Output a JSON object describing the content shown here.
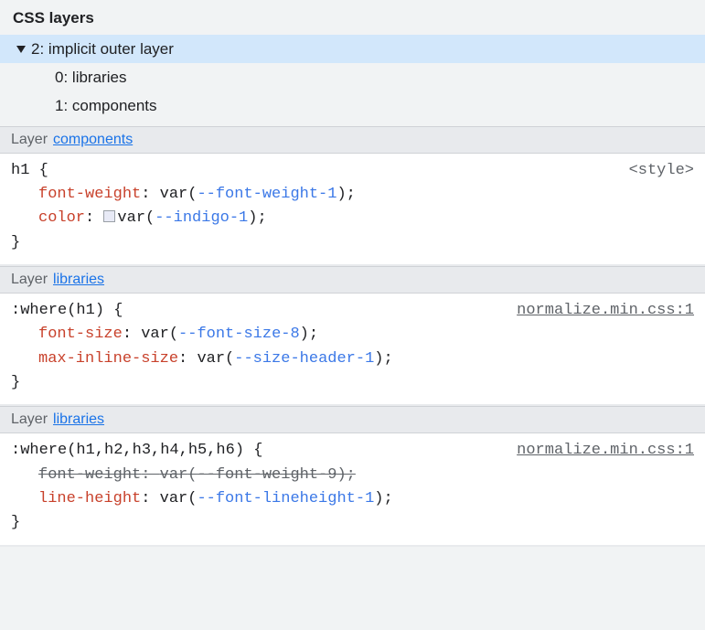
{
  "panel": {
    "title": "CSS layers"
  },
  "tree": {
    "root": {
      "index": "2",
      "label": "implicit outer layer"
    },
    "children": [
      {
        "index": "0",
        "label": "libraries"
      },
      {
        "index": "1",
        "label": "components"
      }
    ]
  },
  "sections": [
    {
      "layer_prefix": "Layer",
      "layer_name": "components",
      "selector": "h1 {",
      "source": "<style>",
      "source_is_link": false,
      "decls": [
        {
          "prop": "font-weight",
          "fn": "var",
          "var": "--font-weight-1",
          "swatch": false,
          "strike": false
        },
        {
          "prop": "color",
          "fn": "var",
          "var": "--indigo-1",
          "swatch": true,
          "strike": false
        }
      ],
      "close": "}"
    },
    {
      "layer_prefix": "Layer",
      "layer_name": "libraries",
      "selector": ":where(h1) {",
      "source": "normalize.min.css:1",
      "source_is_link": true,
      "decls": [
        {
          "prop": "font-size",
          "fn": "var",
          "var": "--font-size-8",
          "swatch": false,
          "strike": false
        },
        {
          "prop": "max-inline-size",
          "fn": "var",
          "var": "--size-header-1",
          "swatch": false,
          "strike": false
        }
      ],
      "close": "}"
    },
    {
      "layer_prefix": "Layer",
      "layer_name": "libraries",
      "selector": ":where(h1,h2,h3,h4,h5,h6) {",
      "source": "normalize.min.css:1",
      "source_is_link": true,
      "decls": [
        {
          "prop": "font-weight",
          "fn": "var",
          "var": "--font-weight-9",
          "swatch": false,
          "strike": true
        },
        {
          "prop": "line-height",
          "fn": "var",
          "var": "--font-lineheight-1",
          "swatch": false,
          "strike": false
        }
      ],
      "close": "}"
    }
  ]
}
